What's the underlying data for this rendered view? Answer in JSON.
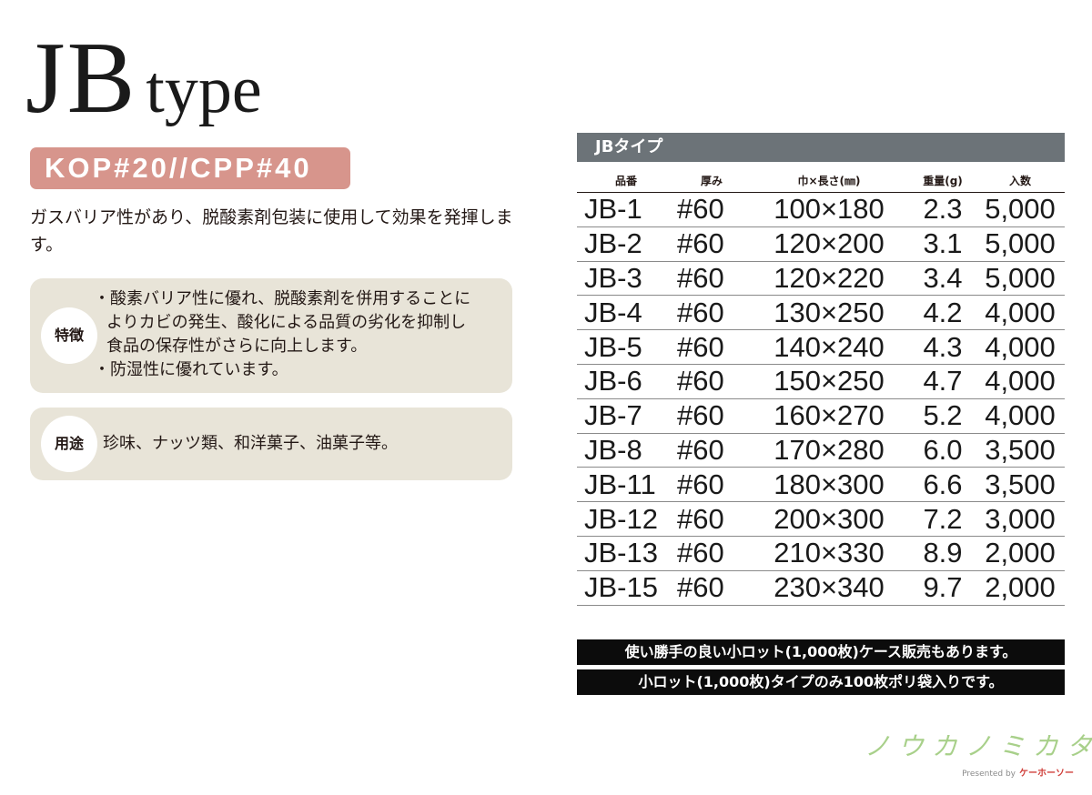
{
  "title": {
    "main": "JB",
    "sub": "type"
  },
  "spec_badge": "KOP#20//CPP#40",
  "intro": "ガスバリア性があり、脱酸素剤包装に使用して効果を発揮します。",
  "features": {
    "label": "特徴",
    "lines": [
      "・酸素バリア性に優れ、脱酸素剤を併用することに",
      "よりカビの発生、酸化による品質の劣化を抑制し",
      "食品の保存性がさらに向上します。",
      "・防湿性に優れています。"
    ]
  },
  "uses": {
    "label": "用途",
    "text": "珍味、ナッツ類、和洋菓子、油菓子等。"
  },
  "table": {
    "title": "JBタイプ",
    "columns": [
      "品番",
      "厚み",
      "巾×長さ(㎜)",
      "重量(g)",
      "入数"
    ],
    "rows": [
      [
        "JB-1",
        "#60",
        "100×180",
        "2.3",
        "5,000"
      ],
      [
        "JB-2",
        "#60",
        "120×200",
        "3.1",
        "5,000"
      ],
      [
        "JB-3",
        "#60",
        "120×220",
        "3.4",
        "5,000"
      ],
      [
        "JB-4",
        "#60",
        "130×250",
        "4.2",
        "4,000"
      ],
      [
        "JB-5",
        "#60",
        "140×240",
        "4.3",
        "4,000"
      ],
      [
        "JB-6",
        "#60",
        "150×250",
        "4.7",
        "4,000"
      ],
      [
        "JB-7",
        "#60",
        "160×270",
        "5.2",
        "4,000"
      ],
      [
        "JB-8",
        "#60",
        "170×280",
        "6.0",
        "3,500"
      ],
      [
        "JB-11",
        "#60",
        "180×300",
        "6.6",
        "3,500"
      ],
      [
        "JB-12",
        "#60",
        "200×300",
        "7.2",
        "3,000"
      ],
      [
        "JB-13",
        "#60",
        "210×330",
        "8.9",
        "2,000"
      ],
      [
        "JB-15",
        "#60",
        "230×340",
        "9.7",
        "2,000"
      ]
    ]
  },
  "notes": [
    "使い勝手の良い小ロット(1,000枚)ケース販売もあります。",
    "小ロット(1,000枚)タイプのみ100枚ポリ袋入りです。"
  ],
  "brand": {
    "name": "ノウカノミカタ",
    "presented_by": "Presented by",
    "maker": "ケーホーソー"
  },
  "colors": {
    "badge": "#d7958c",
    "box_bg": "#e8e4d8",
    "table_header": "#6c7378",
    "note_bg": "#0c0c0c",
    "brand_green": "#a8d08a",
    "maker_red": "#d0413c"
  }
}
